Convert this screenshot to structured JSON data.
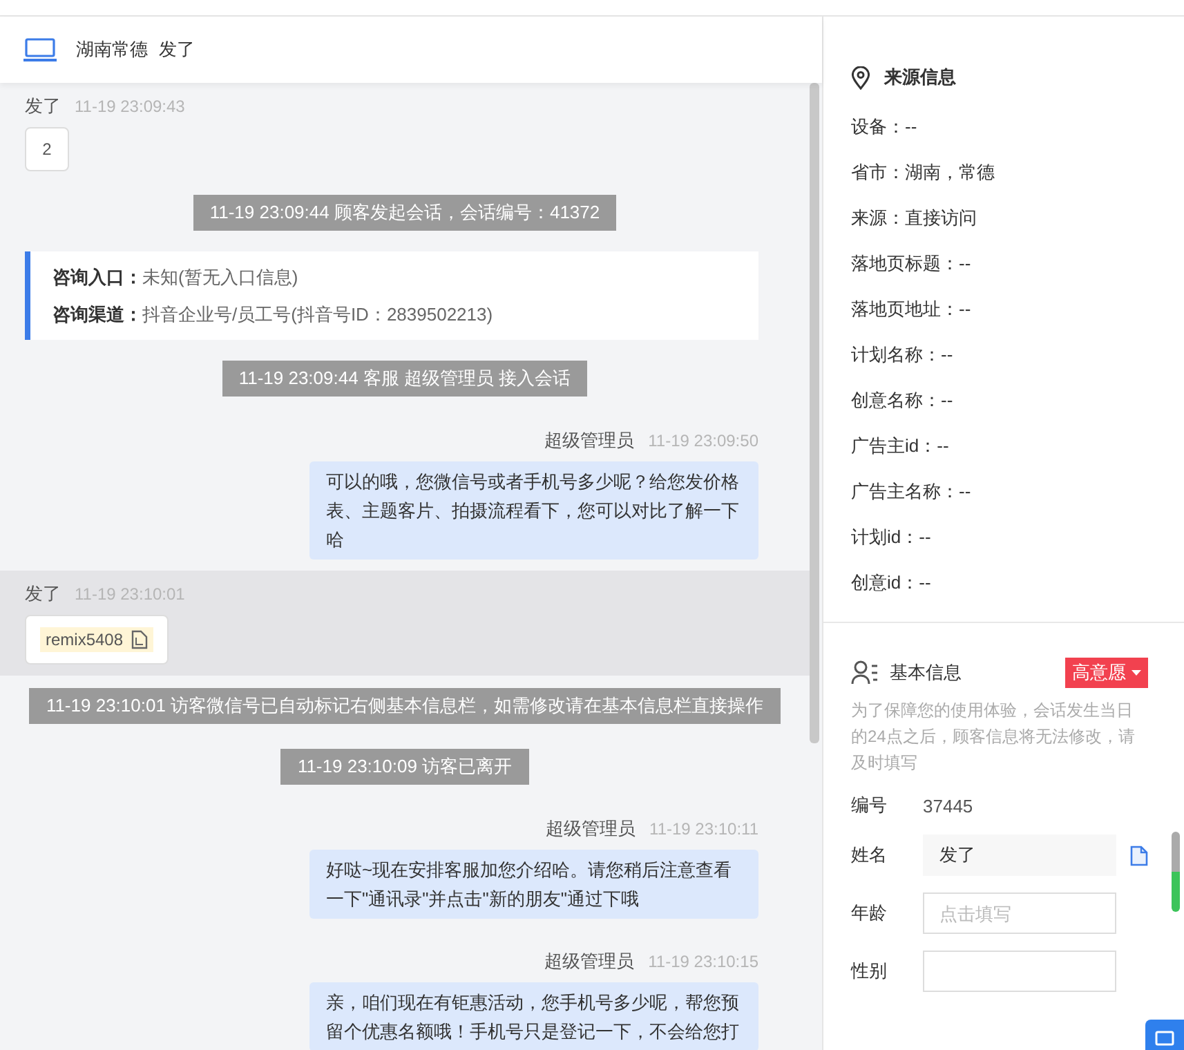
{
  "header": {
    "region": "湖南常德",
    "name": "发了"
  },
  "messages": [
    {
      "kind": "visitor",
      "sender": "发了",
      "time": "11-19 23:09:43",
      "text": "2",
      "highlighted": false,
      "copyable": false
    },
    {
      "kind": "system",
      "text": "11-19 23:09:44 顾客发起会话，会话编号：41372"
    },
    {
      "kind": "info",
      "lines": [
        {
          "label": "咨询入口：",
          "value": "未知(暂无入口信息)"
        },
        {
          "label": "咨询渠道：",
          "value": "抖音企业号/员工号(抖音号ID：2839502213)"
        }
      ]
    },
    {
      "kind": "system",
      "text": "11-19 23:09:44 客服 超级管理员 接入会话"
    },
    {
      "kind": "agent",
      "sender": "超级管理员",
      "time": "11-19 23:09:50",
      "text": "可以的哦，您微信号或者手机号多少呢？给您发价格表、主题客片、拍摄流程看下，您可以对比了解一下哈"
    },
    {
      "kind": "visitor",
      "sender": "发了",
      "time": "11-19 23:10:01",
      "text": "remix5408",
      "highlighted": true,
      "copyable": true
    },
    {
      "kind": "system",
      "text": "11-19 23:10:01 访客微信号已自动标记右侧基本信息栏，如需修改请在基本信息栏直接操作"
    },
    {
      "kind": "system",
      "text": "11-19 23:10:09 访客已离开"
    },
    {
      "kind": "agent",
      "sender": "超级管理员",
      "time": "11-19 23:10:11",
      "text": "好哒~现在安排客服加您介绍哈。请您稍后注意查看一下\"通讯录\"并点击\"新的朋友\"通过下哦"
    },
    {
      "kind": "agent",
      "sender": "超级管理员",
      "time": "11-19 23:10:15",
      "text": "亲，咱们现在有钜惠活动，您手机号多少呢，帮您预留个优惠名额哦！手机号只是登记一下，不会给您打"
    }
  ],
  "source_info": {
    "title": "来源信息",
    "rows": [
      "设备：--",
      "省市：湖南，常德",
      "来源：直接访问",
      "落地页标题：--",
      "落地页地址：--",
      "计划名称：--",
      "创意名称：--",
      "广告主id：--",
      "广告主名称：--",
      "计划id：--",
      "创意id：--"
    ]
  },
  "basic_info": {
    "title": "基本信息",
    "intent_tag": "高意愿",
    "notice": "为了保障您的使用体验，会话发生当日的24点之后，顾客信息将无法修改，请及时填写",
    "fields": [
      {
        "kind": "text",
        "label": "编号",
        "value": "37445"
      },
      {
        "kind": "readonly",
        "label": "姓名",
        "value": "发了"
      },
      {
        "kind": "input",
        "label": "年龄",
        "placeholder": "点击填写"
      },
      {
        "kind": "input",
        "label": "性别"
      }
    ]
  }
}
